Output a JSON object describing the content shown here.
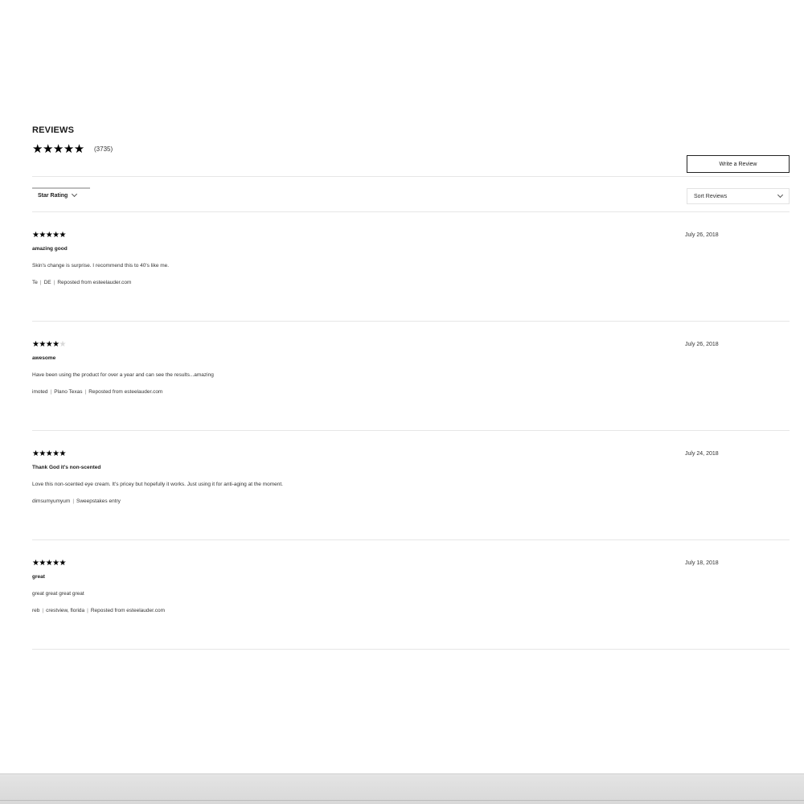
{
  "reviews": {
    "title": "REVIEWS",
    "summary": {
      "stars": "★★★★★",
      "count": "(3735)"
    },
    "write_label": "Write a Review",
    "filter_label": "Star Rating",
    "sort_label": "Sort Reviews",
    "items": [
      {
        "rating": 5,
        "filled": "★★★★★",
        "empty": "",
        "title": "amazing good",
        "body": "Skin's change is surprise. I recommend this to 40's like me.",
        "author": "Te",
        "location": "DE",
        "source": "Reposted from esteelauder.com",
        "date": "July 26, 2018"
      },
      {
        "rating": 4,
        "filled": "★★★★",
        "empty": "★",
        "title": "awesome",
        "body": "Have been using the product for over a year and can see the results...amazing",
        "author": "imoted",
        "location": "Plano Texas",
        "source": "Reposted from esteelauder.com",
        "date": "July 26, 2018"
      },
      {
        "rating": 5,
        "filled": "★★★★★",
        "empty": "",
        "title": "Thank God it's non-scented",
        "body": "Love this non-scented eye cream. It's pricey but hopefully it works. Just using it for anti-aging at the moment.",
        "author": "dimsumyumyum",
        "source": "Sweepstakes entry",
        "date": "July 24, 2018"
      },
      {
        "rating": 5,
        "filled": "★★★★★",
        "empty": "",
        "title": "great",
        "body": "great great great great",
        "author": "reb",
        "location": "crestview, florida",
        "source": "Reposted from esteelauder.com",
        "date": "July 18, 2018"
      }
    ]
  }
}
